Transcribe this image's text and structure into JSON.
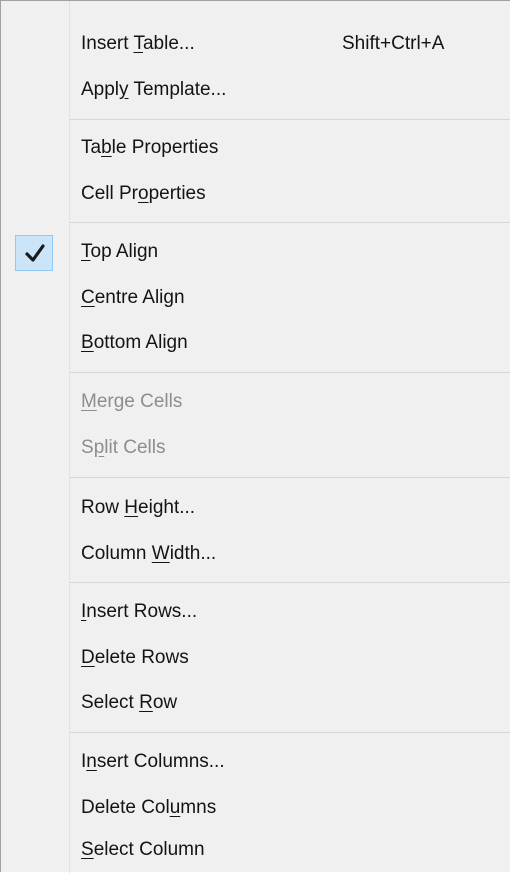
{
  "context_menu": {
    "items": [
      {
        "pre": "Insert ",
        "key": "T",
        "post": "able...",
        "shortcut": "Shift+Ctrl+A",
        "enabled": true,
        "checked": false
      },
      {
        "pre": "Appl",
        "key": "y",
        "post": " Template...",
        "shortcut": "",
        "enabled": true,
        "checked": false
      },
      {
        "pre": "Ta",
        "key": "b",
        "post": "le Properties",
        "shortcut": "",
        "enabled": true,
        "checked": false
      },
      {
        "pre": "Cell Pr",
        "key": "o",
        "post": "perties",
        "shortcut": "",
        "enabled": true,
        "checked": false
      },
      {
        "pre": "",
        "key": "T",
        "post": "op Align",
        "shortcut": "",
        "enabled": true,
        "checked": true
      },
      {
        "pre": "",
        "key": "C",
        "post": "entre Align",
        "shortcut": "",
        "enabled": true,
        "checked": false
      },
      {
        "pre": "",
        "key": "B",
        "post": "ottom Align",
        "shortcut": "",
        "enabled": true,
        "checked": false
      },
      {
        "pre": "",
        "key": "M",
        "post": "erge Cells",
        "shortcut": "",
        "enabled": false,
        "checked": false
      },
      {
        "pre": "S",
        "key": "p",
        "post": "lit Cells",
        "shortcut": "",
        "enabled": false,
        "checked": false
      },
      {
        "pre": "Row ",
        "key": "H",
        "post": "eight...",
        "shortcut": "",
        "enabled": true,
        "checked": false
      },
      {
        "pre": "Column ",
        "key": "W",
        "post": "idth...",
        "shortcut": "",
        "enabled": true,
        "checked": false
      },
      {
        "pre": "",
        "key": "I",
        "post": "nsert Rows...",
        "shortcut": "",
        "enabled": true,
        "checked": false
      },
      {
        "pre": "",
        "key": "D",
        "post": "elete Rows",
        "shortcut": "",
        "enabled": true,
        "checked": false
      },
      {
        "pre": "Select ",
        "key": "R",
        "post": "ow",
        "shortcut": "",
        "enabled": true,
        "checked": false
      },
      {
        "pre": "I",
        "key": "n",
        "post": "sert Columns...",
        "shortcut": "",
        "enabled": true,
        "checked": false
      },
      {
        "pre": "Delete Col",
        "key": "u",
        "post": "mns",
        "shortcut": "",
        "enabled": true,
        "checked": false
      },
      {
        "pre": "",
        "key": "S",
        "post": "elect Column",
        "shortcut": "",
        "enabled": true,
        "checked": false
      }
    ],
    "check_icon": "checkmark-icon",
    "colors": {
      "background": "#f0f0f0",
      "text": "#141414",
      "disabled_text": "#8d8d8d",
      "separator": "#d7d7d7",
      "check_highlight": "#cce4f7",
      "check_border": "#90c8f6"
    }
  }
}
